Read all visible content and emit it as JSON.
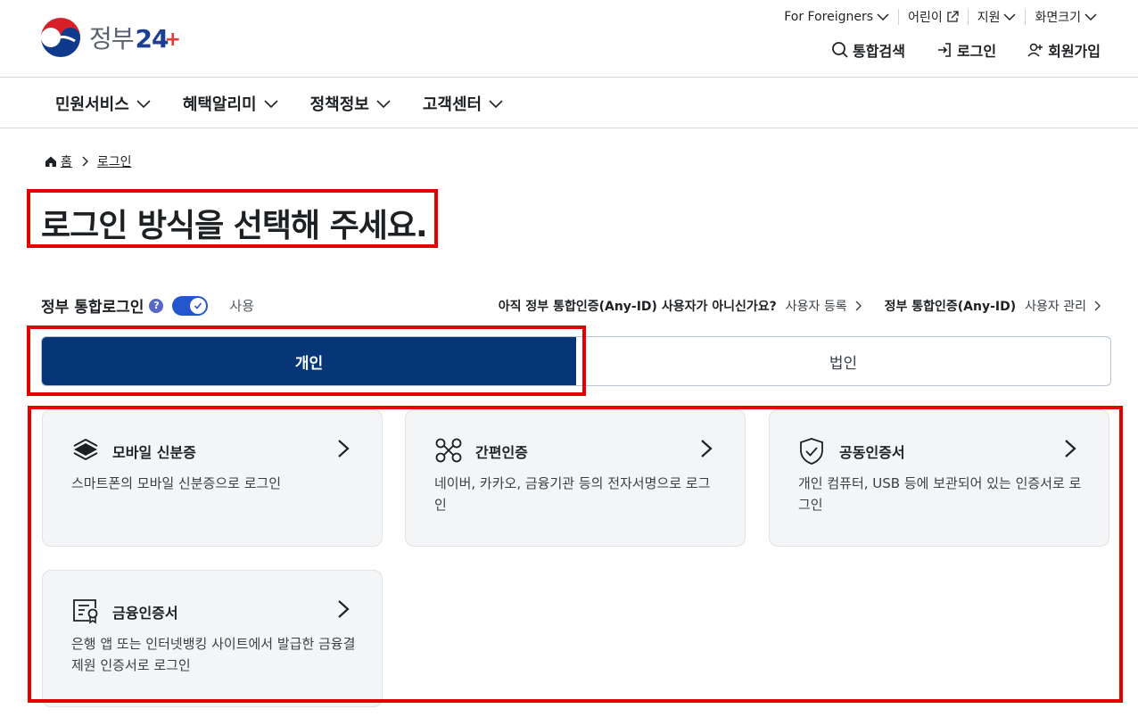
{
  "header": {
    "logo_text": "정부",
    "logo_num": "24",
    "logo_plus": "+",
    "util": [
      {
        "label": "For Foreigners"
      },
      {
        "label": "어린이"
      },
      {
        "label": "지원"
      },
      {
        "label": "화면크기"
      }
    ],
    "search_label": "통합검색",
    "login_label": "로그인",
    "signup_label": "회원가입"
  },
  "gnb": {
    "items": [
      {
        "label": "민원서비스"
      },
      {
        "label": "혜택알리미"
      },
      {
        "label": "정책정보"
      },
      {
        "label": "고객센터"
      }
    ]
  },
  "breadcrumb": {
    "home": "홈",
    "current": "로그인"
  },
  "page_title": "로그인 방식을 선택해 주세요.",
  "toggle": {
    "label": "정부 통합로그인",
    "help": "?",
    "state_label": "사용",
    "enabled": true
  },
  "anyid": {
    "q1": "아직 정부 통합인증(Any-ID) 사용자가 아니신가요?",
    "a1": "사용자 등록",
    "q2": "정부 통합인증(Any-ID)",
    "a2": "사용자 관리"
  },
  "tabs": [
    {
      "label": "개인",
      "active": true
    },
    {
      "label": "법인",
      "active": false
    }
  ],
  "cards": [
    {
      "title": "모바일 신분증",
      "desc": "스마트폰의 모바일 신분증으로 로그인",
      "icon": "mobile-id-icon"
    },
    {
      "title": "간편인증",
      "desc": "네이버, 카카오, 금융기관 등의 전자서명으로 로그인",
      "icon": "simple-auth-icon"
    },
    {
      "title": "공동인증서",
      "desc": "개인 컴퓨터, USB 등에 보관되어 있는 인증서로 로그인",
      "icon": "shield-check-icon"
    },
    {
      "title": "금융인증서",
      "desc": "은행 앱 또는 인터넷뱅킹 사이트에서 발급한 금융결제원 인증서로 로그인",
      "icon": "certificate-icon"
    }
  ],
  "colors": {
    "primary": "#063677",
    "toggle": "#2456d0",
    "highlight": "#e50000"
  }
}
